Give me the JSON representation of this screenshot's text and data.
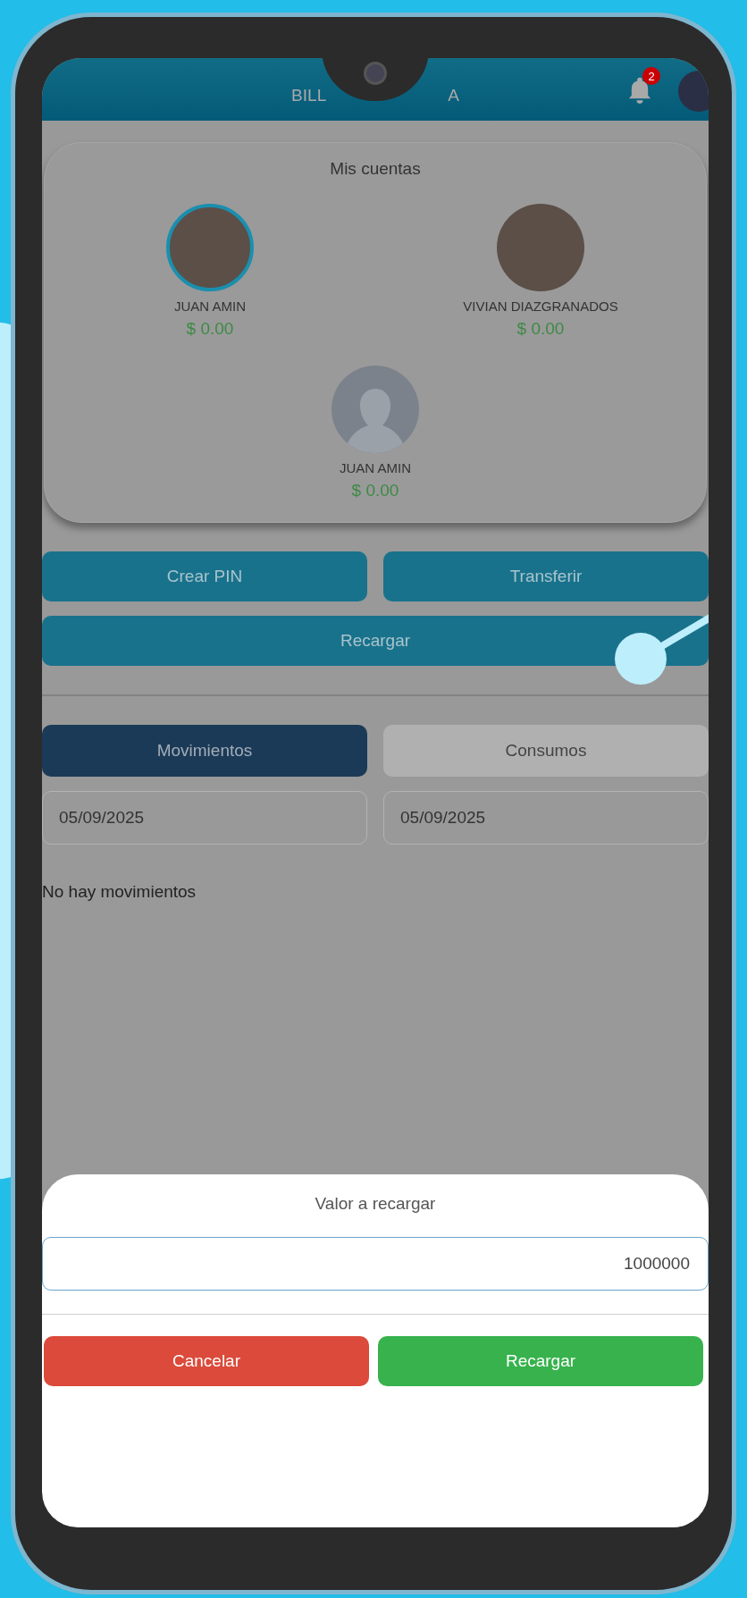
{
  "header": {
    "title_parts": [
      "BILL",
      "A"
    ],
    "notifications": "2"
  },
  "accounts_card": {
    "title": "Mis cuentas",
    "accounts": [
      {
        "name": "JUAN AMIN",
        "balance": "$ 0.00",
        "photo": true,
        "selected": true
      },
      {
        "name": "VIVIAN DIAZGRANADOS",
        "balance": "$ 0.00",
        "photo": true,
        "selected": false
      },
      {
        "name": "JUAN AMIN",
        "balance": "$ 0.00",
        "photo": false,
        "selected": false
      }
    ]
  },
  "actions": [
    {
      "label": "Crear PIN"
    },
    {
      "label": "Transferir"
    },
    {
      "label": "Recargar"
    }
  ],
  "tabs": [
    {
      "label": "Movimientos",
      "selected": true
    },
    {
      "label": "Consumos",
      "selected": false
    }
  ],
  "date_range": {
    "from": "05/09/2025",
    "to": "05/09/2025"
  },
  "empty_message": "No hay movimientos",
  "dialog": {
    "title": "Valor a recargar",
    "amount": "1000000",
    "buttons": [
      {
        "label": "Cancelar",
        "kind": "cancel"
      },
      {
        "label": "Recargar",
        "kind": "confirm"
      }
    ]
  }
}
